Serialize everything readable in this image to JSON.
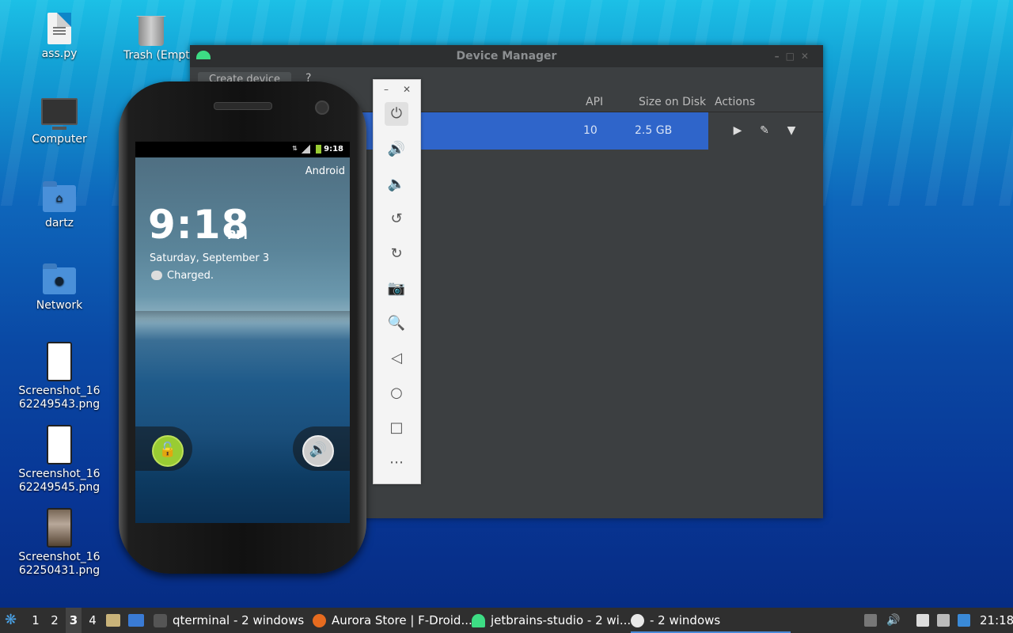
{
  "desktop": {
    "icons": [
      {
        "label": "ass.py"
      },
      {
        "label": "Trash (Empty)"
      },
      {
        "label": "Computer"
      },
      {
        "label": "dartz"
      },
      {
        "label": "Network"
      },
      {
        "label": "Screenshot_1662249543.png"
      },
      {
        "label": "Screenshot_1662249545.png"
      },
      {
        "label": "Screenshot_1662250431.png"
      }
    ]
  },
  "device_manager": {
    "title": "Device Manager",
    "create_label": "Create device",
    "help_label": "?",
    "columns": {
      "api": "API",
      "size": "Size on Disk",
      "actions": "Actions"
    },
    "rows": [
      {
        "api": "10",
        "size": "2.5 GB"
      }
    ]
  },
  "emulator_toolbar": {
    "buttons": [
      "power-icon",
      "volume-up-icon",
      "volume-down-icon",
      "rotate-left-icon",
      "rotate-right-icon",
      "camera-icon",
      "zoom-icon",
      "back-icon",
      "home-icon",
      "overview-icon",
      "more-icon"
    ]
  },
  "phone": {
    "status_time": "9:18",
    "carrier": "Android",
    "clock": "9:18",
    "ampm": "PM",
    "date": "Saturday, September 3",
    "battery_status": "Charged."
  },
  "taskbar": {
    "workspaces": [
      "1",
      "2",
      "3",
      "4"
    ],
    "current_workspace": "3",
    "tasks": [
      {
        "label": "qterminal - 2 windows"
      },
      {
        "label": "Aurora Store | F-Droid..."
      },
      {
        "label": "jetbrains-studio - 2 wi..."
      },
      {
        "label": "- 2 windows"
      }
    ],
    "clock": "21:18"
  }
}
